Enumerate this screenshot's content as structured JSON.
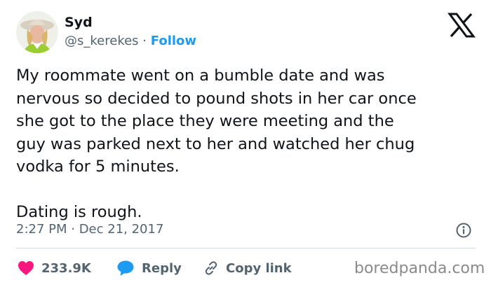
{
  "author": {
    "name": "Syd",
    "handle": "@s_kerekes",
    "separator": "·",
    "follow_label": "Follow"
  },
  "logo_icon": "x-logo-icon",
  "tweet": {
    "paragraph1_lines": [
      "My roommate went on a bumble date and was",
      "nervous so decided to pound shots in her car once",
      "she got to the place they were meeting and the",
      "guy was parked next to her and watched her chug",
      "vodka for 5 minutes."
    ],
    "paragraph2": "Dating is rough.",
    "timestamp": "2:27 PM · Dec 21, 2017"
  },
  "actions": {
    "likes_count": "233.9K",
    "reply_label": "Reply",
    "copy_link_label": "Copy link"
  },
  "watermark": "boredpanda.com",
  "colors": {
    "accent": "#1d9bf0",
    "heart": "#f91880",
    "text": "#0f1419",
    "muted": "#536471",
    "divider": "#cfd9de"
  }
}
